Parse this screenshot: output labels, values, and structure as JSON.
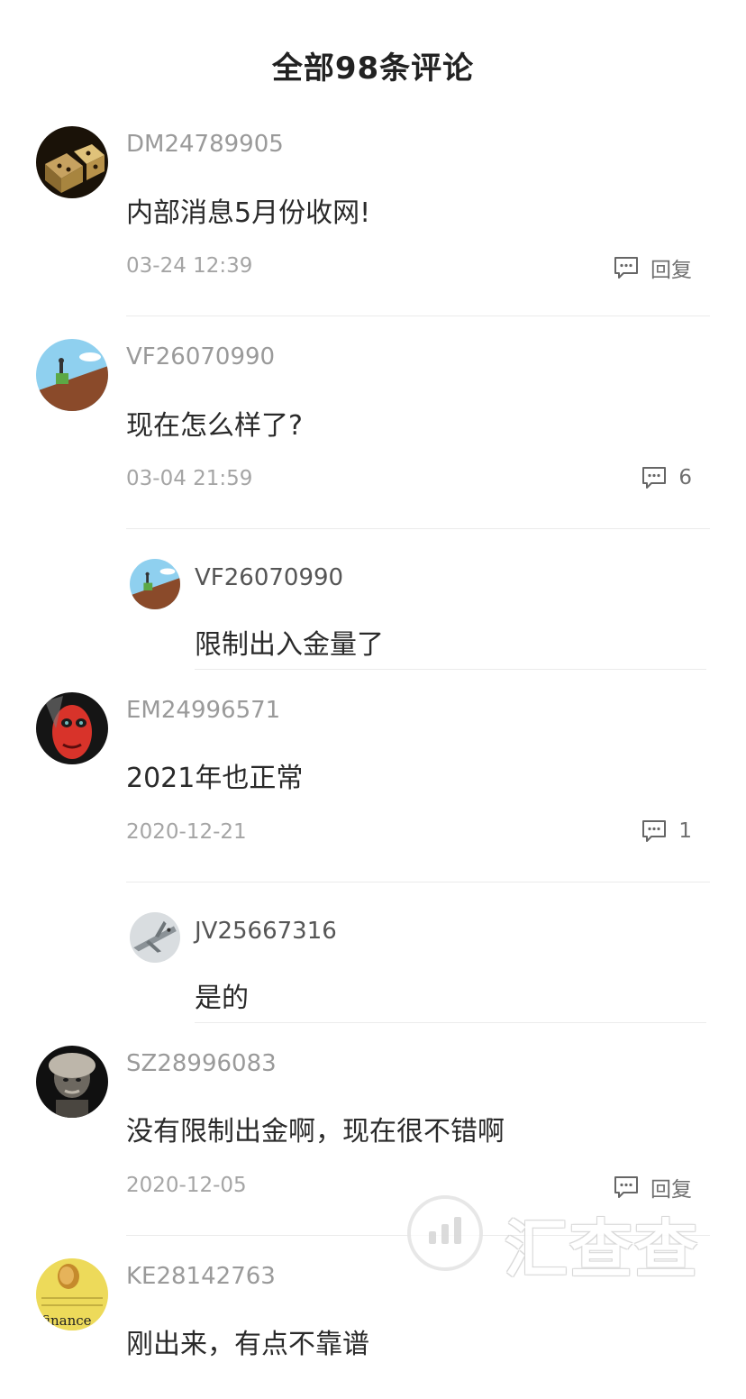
{
  "header": {
    "title": "全部98条评论"
  },
  "comments": [
    {
      "username": "DM24789905",
      "text": "内部消息5月份收网!",
      "time": "03-24 12:39",
      "action_label": "回复",
      "avatar_icon": "dice-avatar"
    },
    {
      "username": "VF26070990",
      "text": "现在怎么样了?",
      "time": "03-04 21:59",
      "action_label": "6",
      "avatar_icon": "cartoon-hill-avatar",
      "replies": [
        {
          "username": "VF26070990",
          "text": "限制出入金量了",
          "avatar_icon": "cartoon-hill-avatar"
        }
      ]
    },
    {
      "username": "EM24996571",
      "text": "2021年也正常",
      "time": "2020-12-21",
      "action_label": "1",
      "avatar_icon": "painted-face-avatar",
      "replies": [
        {
          "username": "JV25667316",
          "text": "是的",
          "avatar_icon": "jet-avatar"
        }
      ]
    },
    {
      "username": "SZ28996083",
      "text": "没有限制出金啊，现在很不错啊",
      "time": "2020-12-05",
      "action_label": "回复",
      "avatar_icon": "portrait-avatar"
    },
    {
      "username": "KE28142763",
      "text": "刚出来，有点不靠谱",
      "avatar_icon": "finance-coin-avatar",
      "avatar_text": "finance"
    }
  ],
  "watermark": {
    "text": "汇查查",
    "icon": "chart-search-icon"
  },
  "colors": {
    "username": "#9a9a9a",
    "text": "#2a2a2a",
    "time": "#a5a5a5",
    "divider": "#ebebeb"
  }
}
